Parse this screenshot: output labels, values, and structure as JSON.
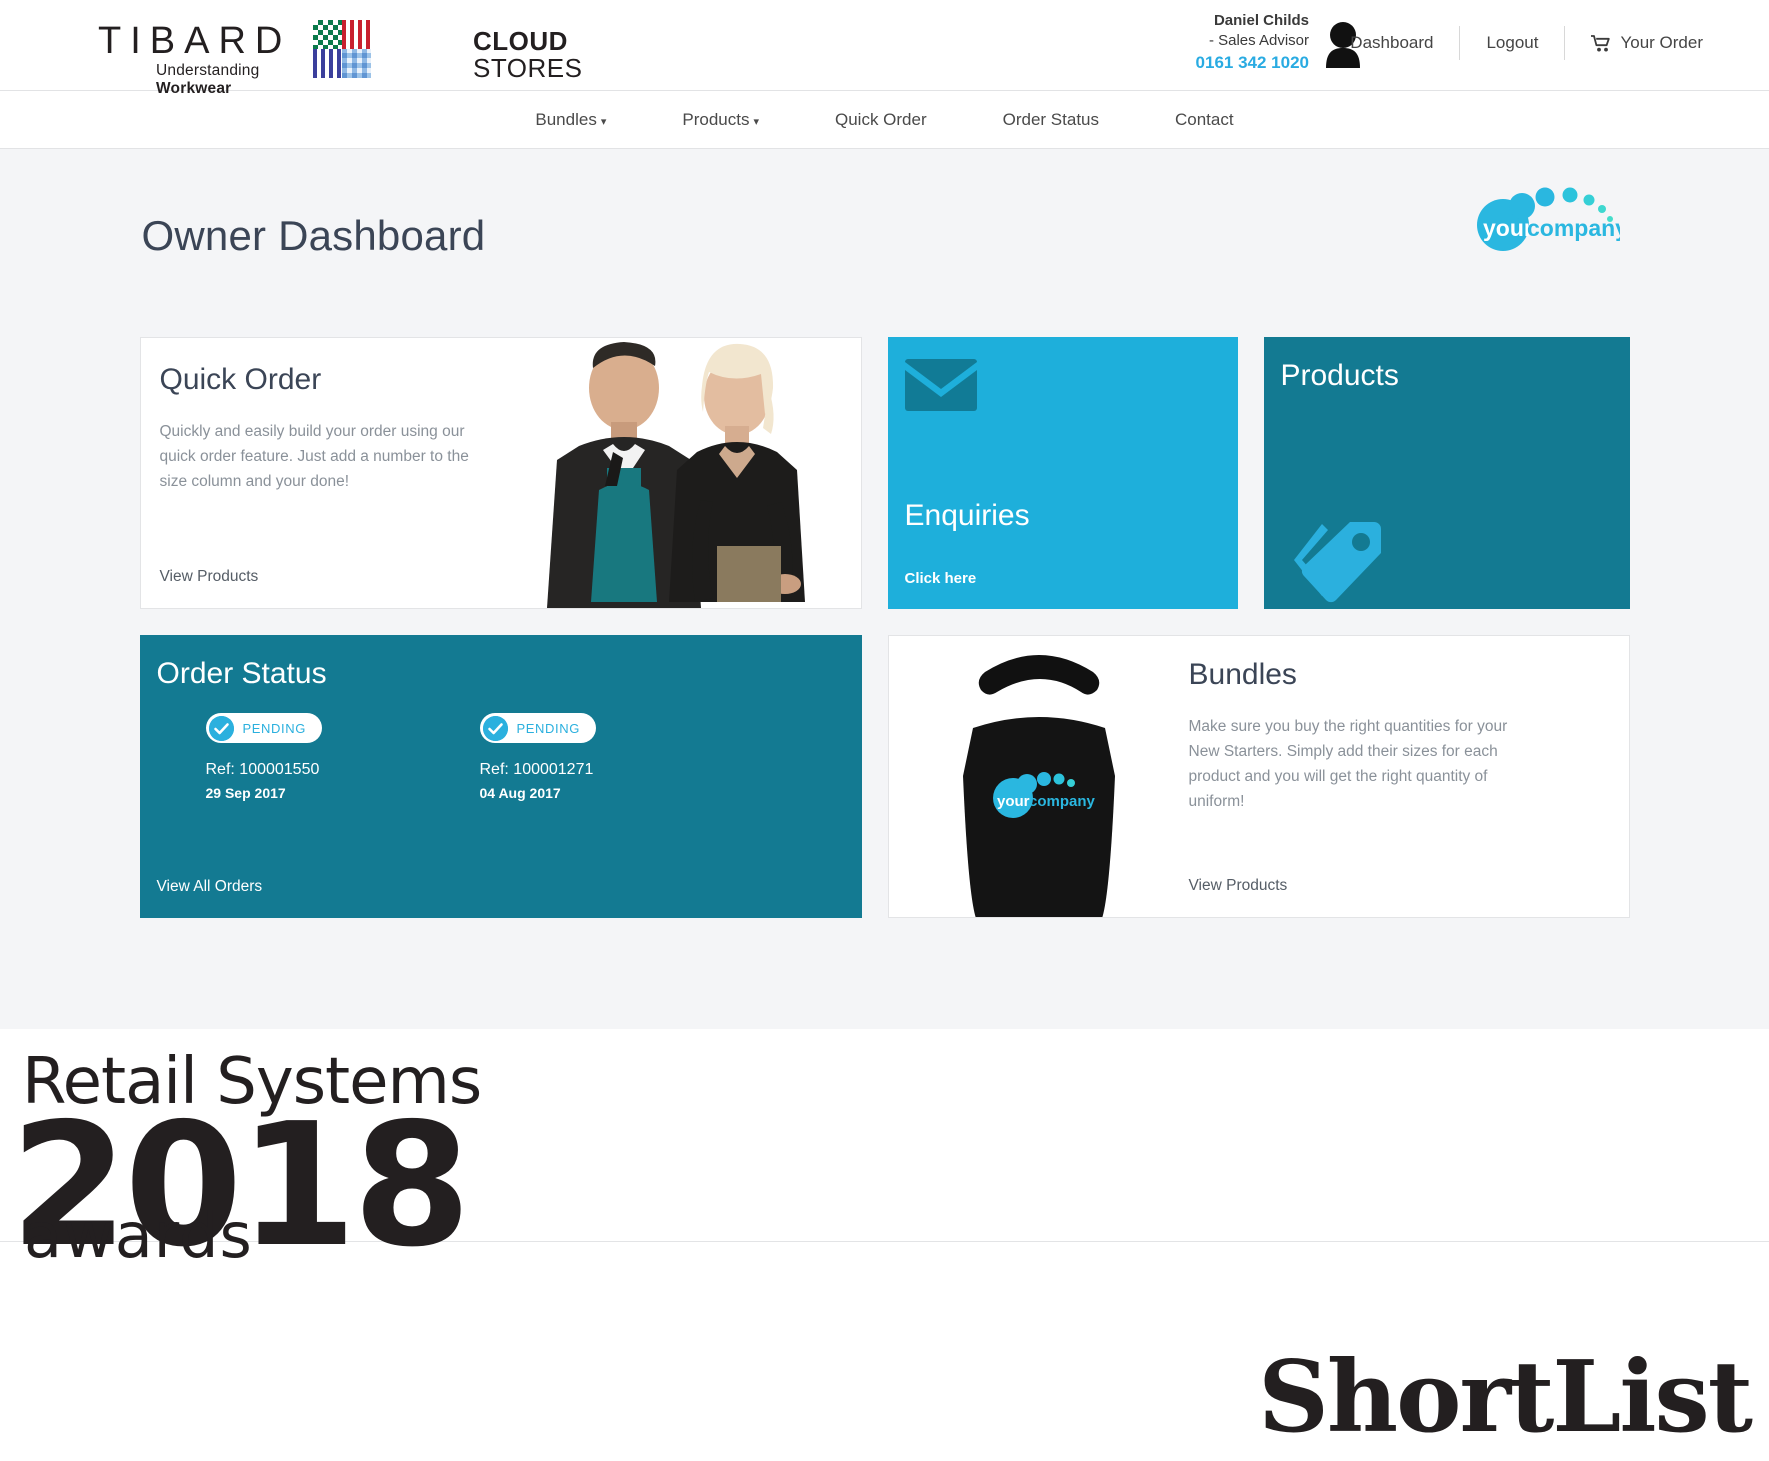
{
  "header": {
    "brand": {
      "tibard_word": "TIBARD",
      "tibard_tagline_light": "Understanding ",
      "tibard_tagline_bold": "Workwear",
      "cloud_line1": "CLOUD",
      "cloud_line2": "STORES",
      "swatch_icon": "fabric-swatch-icon"
    },
    "user": {
      "name": "Daniel Childs",
      "role": "- Sales Advisor",
      "phone": "0161 342 1020",
      "avatar_icon": "user-avatar-icon"
    },
    "links": [
      {
        "label": "Dashboard",
        "icon": null
      },
      {
        "label": "Logout",
        "icon": null
      },
      {
        "label": "Your Order",
        "icon": "shopping-cart-icon"
      }
    ]
  },
  "nav": {
    "items": [
      {
        "label": "Bundles",
        "has_caret": true
      },
      {
        "label": "Products",
        "has_caret": true
      },
      {
        "label": "Quick Order",
        "has_caret": false
      },
      {
        "label": "Order Status",
        "has_caret": false
      },
      {
        "label": "Contact",
        "has_caret": false
      }
    ],
    "caret": "▾"
  },
  "page": {
    "title": "Owner Dashboard",
    "company_logo": {
      "word1": "your",
      "word2": "company",
      "icon": "your-company-logo"
    }
  },
  "cards": {
    "quick_order": {
      "title": "Quick Order",
      "body": "Quickly and easily build your order using our quick order feature. Just add a number to the size column and your done!",
      "link": "View Products",
      "image_icon": "staff-in-uniform-photo"
    },
    "enquiries": {
      "title": "Enquiries",
      "link": "Click here",
      "icon": "envelope-icon",
      "bg_color": "#1eafdb"
    },
    "products": {
      "title": "Products",
      "icon": "tags-icon",
      "bg_color": "#137a92"
    },
    "order_status": {
      "title": "Order Status",
      "link": "View All Orders",
      "bg_color": "#137a92",
      "orders": [
        {
          "status": "PENDING",
          "ref": "Ref: 100001550",
          "date": "29 Sep 2017",
          "check_icon": "check-circle-icon"
        },
        {
          "status": "PENDING",
          "ref": "Ref: 100001271",
          "date": "04 Aug 2017",
          "check_icon": "check-circle-icon"
        }
      ]
    },
    "bundles": {
      "title": "Bundles",
      "body": "Make sure you buy the right quantities for your New Starters. Simply add their sizes for each product and you will get the right quantity of uniform!",
      "link": "View Products",
      "image_icon": "black-apron-photo"
    }
  },
  "awards_footer": {
    "line_retail": "Retail Systems",
    "year": "2018",
    "awards_word": "awards",
    "shortlist": "ShortList"
  }
}
